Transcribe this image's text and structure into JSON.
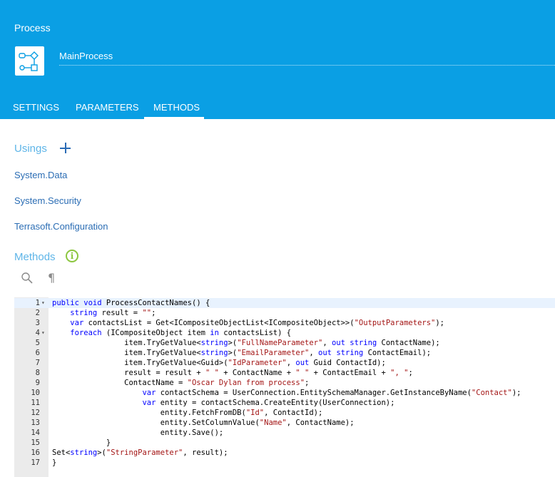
{
  "header": {
    "title": "Process",
    "process_name": "MainProcess"
  },
  "tabs": [
    {
      "label": "SETTINGS",
      "active": false
    },
    {
      "label": "PARAMETERS",
      "active": false
    },
    {
      "label": "METHODS",
      "active": true
    }
  ],
  "usings": {
    "title": "Usings",
    "items": [
      "System.Data",
      "System.Security",
      "Terrasoft.Configuration"
    ]
  },
  "methods": {
    "title": "Methods",
    "info_icon_glyph": "i"
  },
  "toolbar": {
    "search_icon": "search-icon",
    "pilcrow_glyph": "¶"
  },
  "editor": {
    "lines": [
      {
        "n": "1",
        "fold": true,
        "tokens": [
          {
            "t": "public",
            "k": 1
          },
          {
            "t": " "
          },
          {
            "t": "void",
            "k": 1
          },
          {
            "t": " ProcessContactNames() {"
          }
        ]
      },
      {
        "n": "2",
        "fold": false,
        "tokens": [
          {
            "t": "    "
          },
          {
            "t": "string",
            "k": 1
          },
          {
            "t": " result = "
          },
          {
            "t": "\"\"",
            "s": 1
          },
          {
            "t": ";"
          }
        ]
      },
      {
        "n": "3",
        "fold": false,
        "tokens": [
          {
            "t": "    "
          },
          {
            "t": "var",
            "k": 1
          },
          {
            "t": " contactsList = Get<ICompositeObjectList<ICompositeObject>>("
          },
          {
            "t": "\"OutputParameters\"",
            "s": 1
          },
          {
            "t": ");"
          }
        ]
      },
      {
        "n": "4",
        "fold": true,
        "tokens": [
          {
            "t": "    "
          },
          {
            "t": "foreach",
            "k": 1
          },
          {
            "t": " (ICompositeObject item "
          },
          {
            "t": "in",
            "k": 1
          },
          {
            "t": " contactsList) {"
          }
        ]
      },
      {
        "n": "5",
        "fold": false,
        "tokens": [
          {
            "t": "                item.TryGetValue<"
          },
          {
            "t": "string",
            "k": 1
          },
          {
            "t": ">("
          },
          {
            "t": "\"FullNameParameter\"",
            "s": 1
          },
          {
            "t": ", "
          },
          {
            "t": "out",
            "k": 1
          },
          {
            "t": " "
          },
          {
            "t": "string",
            "k": 1
          },
          {
            "t": " ContactName);"
          }
        ]
      },
      {
        "n": "6",
        "fold": false,
        "tokens": [
          {
            "t": "                item.TryGetValue<"
          },
          {
            "t": "string",
            "k": 1
          },
          {
            "t": ">("
          },
          {
            "t": "\"EmailParameter\"",
            "s": 1
          },
          {
            "t": ", "
          },
          {
            "t": "out",
            "k": 1
          },
          {
            "t": " "
          },
          {
            "t": "string",
            "k": 1
          },
          {
            "t": " ContactEmail);"
          }
        ]
      },
      {
        "n": "7",
        "fold": false,
        "tokens": [
          {
            "t": "                item.TryGetValue<Guid>("
          },
          {
            "t": "\"IdParameter\"",
            "s": 1
          },
          {
            "t": ", "
          },
          {
            "t": "out",
            "k": 1
          },
          {
            "t": " Guid ContactId);"
          }
        ]
      },
      {
        "n": "8",
        "fold": false,
        "tokens": [
          {
            "t": "                result = result + "
          },
          {
            "t": "\" \"",
            "s": 1
          },
          {
            "t": " + ContactName + "
          },
          {
            "t": "\" \"",
            "s": 1
          },
          {
            "t": " + ContactEmail + "
          },
          {
            "t": "\", \"",
            "s": 1
          },
          {
            "t": ";"
          }
        ]
      },
      {
        "n": "9",
        "fold": false,
        "tokens": [
          {
            "t": "                ContactName = "
          },
          {
            "t": "\"Oscar Dylan from process\"",
            "s": 1
          },
          {
            "t": ";"
          }
        ]
      },
      {
        "n": "10",
        "fold": false,
        "tokens": [
          {
            "t": "                    "
          },
          {
            "t": "var",
            "k": 1
          },
          {
            "t": " contactSchema = UserConnection.EntitySchemaManager.GetInstanceByName("
          },
          {
            "t": "\"Contact\"",
            "s": 1
          },
          {
            "t": ");"
          }
        ]
      },
      {
        "n": "11",
        "fold": false,
        "tokens": [
          {
            "t": "                    "
          },
          {
            "t": "var",
            "k": 1
          },
          {
            "t": " entity = contactSchema.CreateEntity(UserConnection);"
          }
        ]
      },
      {
        "n": "12",
        "fold": false,
        "tokens": [
          {
            "t": "                        entity.FetchFromDB("
          },
          {
            "t": "\"Id\"",
            "s": 1
          },
          {
            "t": ", ContactId);"
          }
        ]
      },
      {
        "n": "13",
        "fold": false,
        "tokens": [
          {
            "t": "                        entity.SetColumnValue("
          },
          {
            "t": "\"Name\"",
            "s": 1
          },
          {
            "t": ", ContactName);"
          }
        ]
      },
      {
        "n": "14",
        "fold": false,
        "tokens": [
          {
            "t": "                        entity.Save();"
          }
        ]
      },
      {
        "n": "15",
        "fold": false,
        "tokens": [
          {
            "t": "            }"
          }
        ]
      },
      {
        "n": "16",
        "fold": false,
        "tokens": [
          {
            "t": "Set<"
          },
          {
            "t": "string",
            "k": 1
          },
          {
            "t": ">("
          },
          {
            "t": "\"StringParameter\"",
            "s": 1
          },
          {
            "t": ", result);"
          }
        ]
      },
      {
        "n": "17",
        "fold": false,
        "tokens": [
          {
            "t": "}"
          }
        ]
      }
    ]
  }
}
